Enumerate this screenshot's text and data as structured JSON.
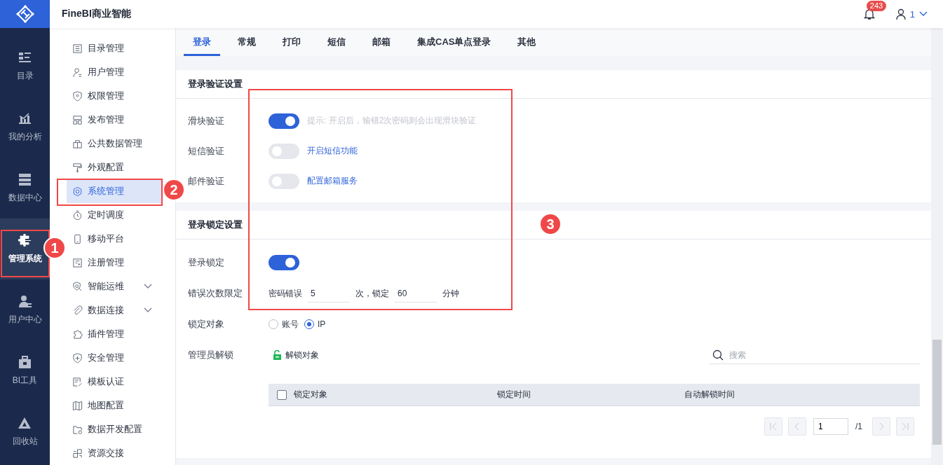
{
  "app": {
    "title": "FineBI商业智能"
  },
  "header": {
    "notification_count": "243",
    "user": "1"
  },
  "rail": [
    {
      "label": "目录",
      "selected": false
    },
    {
      "label": "我的分析",
      "selected": false
    },
    {
      "label": "数据中心",
      "selected": false
    },
    {
      "label": "管理系统",
      "selected": true
    },
    {
      "label": "用户中心",
      "selected": false
    },
    {
      "label": "BI工具",
      "selected": false
    },
    {
      "label": "回收站",
      "selected": false
    }
  ],
  "nav": [
    {
      "label": "目录管理",
      "selected": false,
      "expandable": false
    },
    {
      "label": "用户管理",
      "selected": false,
      "expandable": false
    },
    {
      "label": "权限管理",
      "selected": false,
      "expandable": false
    },
    {
      "label": "发布管理",
      "selected": false,
      "expandable": false
    },
    {
      "label": "公共数据管理",
      "selected": false,
      "expandable": false
    },
    {
      "label": "外观配置",
      "selected": false,
      "expandable": false
    },
    {
      "label": "系统管理",
      "selected": true,
      "expandable": false
    },
    {
      "label": "定时调度",
      "selected": false,
      "expandable": false
    },
    {
      "label": "移动平台",
      "selected": false,
      "expandable": false
    },
    {
      "label": "注册管理",
      "selected": false,
      "expandable": false
    },
    {
      "label": "智能运维",
      "selected": false,
      "expandable": true
    },
    {
      "label": "数据连接",
      "selected": false,
      "expandable": true
    },
    {
      "label": "插件管理",
      "selected": false,
      "expandable": false
    },
    {
      "label": "安全管理",
      "selected": false,
      "expandable": false
    },
    {
      "label": "模板认证",
      "selected": false,
      "expandable": false
    },
    {
      "label": "地图配置",
      "selected": false,
      "expandable": false
    },
    {
      "label": "数据开发配置",
      "selected": false,
      "expandable": false
    },
    {
      "label": "资源交接",
      "selected": false,
      "expandable": false
    }
  ],
  "tabs": [
    {
      "label": "登录",
      "selected": true
    },
    {
      "label": "常规",
      "selected": false
    },
    {
      "label": "打印",
      "selected": false
    },
    {
      "label": "短信",
      "selected": false
    },
    {
      "label": "邮箱",
      "selected": false
    },
    {
      "label": "集成CAS单点登录",
      "selected": false
    },
    {
      "label": "其他",
      "selected": false
    }
  ],
  "sections": [
    {
      "title": "登录验证设置",
      "rows": [
        {
          "kind": "toggle",
          "label": "滑块验证",
          "on": true,
          "hint": "提示: 开启后，输错2次密码则会出现滑块验证"
        },
        {
          "kind": "toggle",
          "label": "短信验证",
          "on": false,
          "link": "开启短信功能"
        },
        {
          "kind": "toggle",
          "label": "邮件验证",
          "on": false,
          "link": "配置邮箱服务"
        }
      ]
    },
    {
      "title": "登录锁定设置",
      "rows": [
        {
          "kind": "toggle",
          "label": "登录锁定",
          "on": true
        },
        {
          "kind": "limit",
          "label": "错误次数限定",
          "prefix": "密码错误",
          "count": "5",
          "middle": "次，锁定",
          "minutes": "60",
          "suffix": "分钟"
        },
        {
          "kind": "radio",
          "label": "锁定对象",
          "options": [
            {
              "label": "账号",
              "selected": false
            },
            {
              "label": "IP",
              "selected": true
            }
          ]
        },
        {
          "kind": "unlock",
          "label": "管理员解锁",
          "action": "解锁对象",
          "search_placeholder": "搜索"
        }
      ]
    }
  ],
  "table": {
    "select_all_checked": false,
    "columns": [
      "锁定对象",
      "锁定时间",
      "自动解锁时间"
    ]
  },
  "pagination": {
    "page": "1",
    "total": "/1"
  },
  "annotations": [
    {
      "number": "1"
    },
    {
      "number": "2"
    },
    {
      "number": "3"
    }
  ]
}
